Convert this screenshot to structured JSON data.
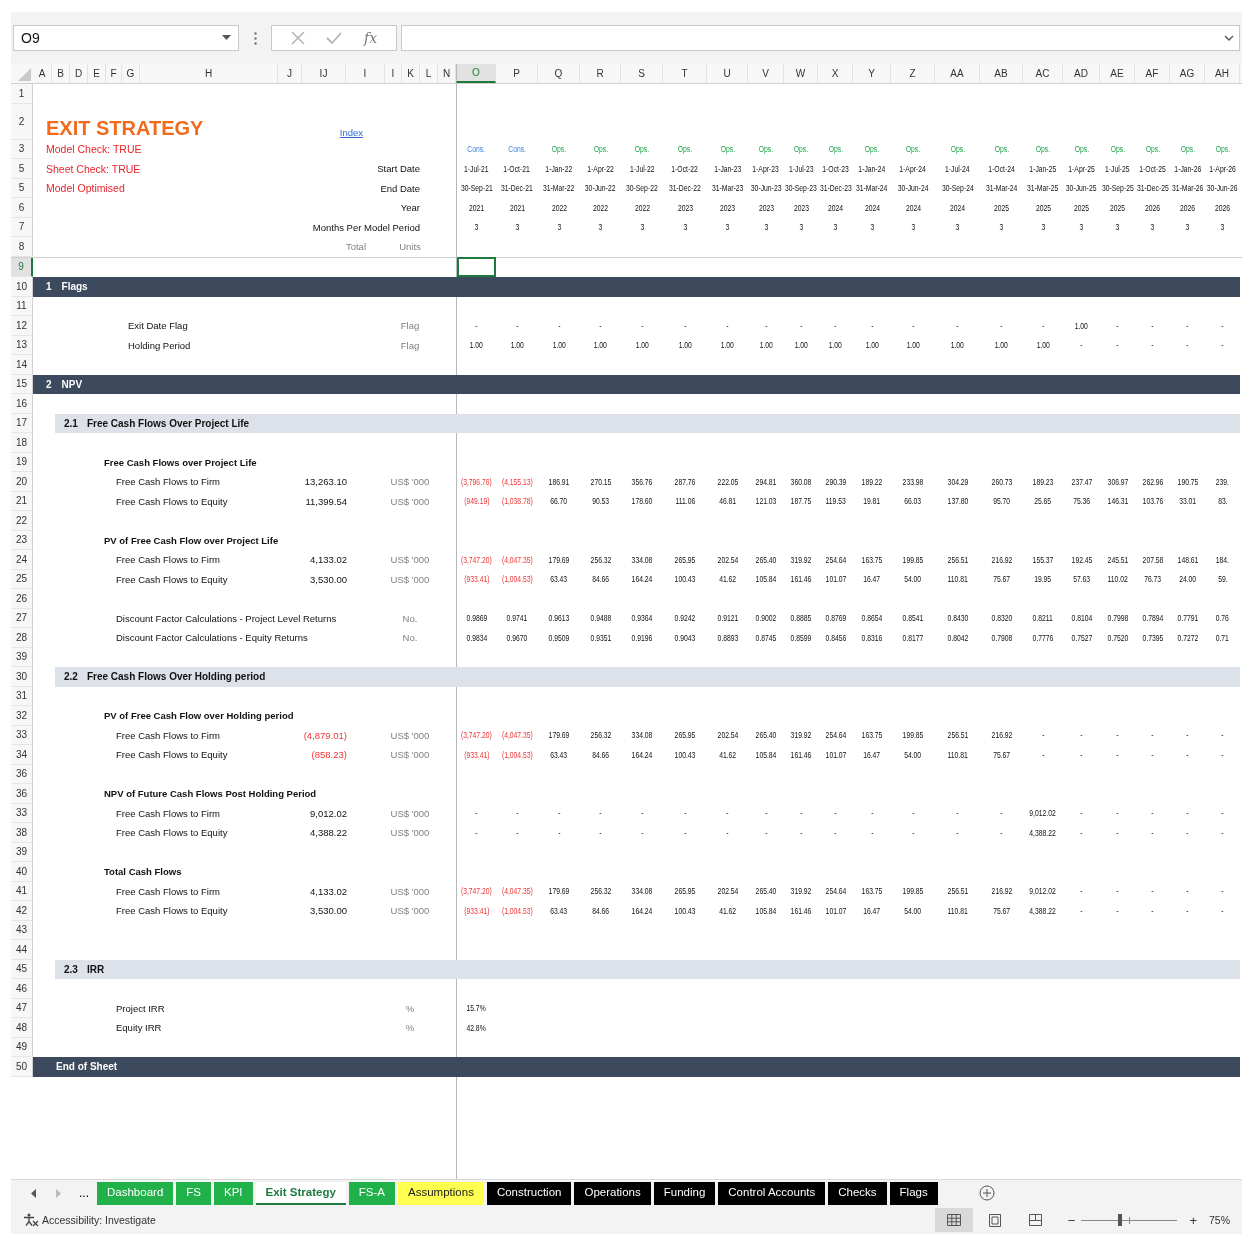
{
  "formula_bar": {
    "name_box": "O9",
    "function_label": "fx"
  },
  "columns": [
    {
      "label": "A",
      "selected": false
    },
    {
      "label": "B",
      "selected": false
    },
    {
      "label": "D",
      "selected": false
    },
    {
      "label": "E",
      "selected": false
    },
    {
      "label": "F",
      "selected": false
    },
    {
      "label": "G",
      "selected": false
    },
    {
      "label": "H",
      "selected": false
    },
    {
      "label": "J",
      "selected": false
    },
    {
      "label": "IJ",
      "selected": false
    },
    {
      "label": "I",
      "selected": false
    },
    {
      "label": "I",
      "selected": false
    },
    {
      "label": "K",
      "selected": false
    },
    {
      "label": "L",
      "selected": false
    },
    {
      "label": "N",
      "selected": false
    },
    {
      "label": "O",
      "selected": true
    },
    {
      "label": "P",
      "selected": false
    },
    {
      "label": "Q",
      "selected": false
    },
    {
      "label": "R",
      "selected": false
    },
    {
      "label": "S",
      "selected": false
    },
    {
      "label": "T",
      "selected": false
    },
    {
      "label": "U",
      "selected": false
    },
    {
      "label": "V",
      "selected": false
    },
    {
      "label": "W",
      "selected": false
    },
    {
      "label": "X",
      "selected": false
    },
    {
      "label": "Y",
      "selected": false
    },
    {
      "label": "Z",
      "selected": false
    },
    {
      "label": "AA",
      "selected": false
    },
    {
      "label": "AB",
      "selected": false
    },
    {
      "label": "AC",
      "selected": false
    },
    {
      "label": "AD",
      "selected": false
    },
    {
      "label": "AE",
      "selected": false
    },
    {
      "label": "AF",
      "selected": false
    },
    {
      "label": "AG",
      "selected": false
    },
    {
      "label": "AH",
      "selected": false
    }
  ],
  "rows": [
    {
      "number": "1",
      "kind": "blank",
      "selected": false
    },
    {
      "number": "2",
      "kind": "title",
      "selected": false,
      "title": "EXIT STRATEGY",
      "link": "Index"
    },
    {
      "number": "3",
      "kind": "phase",
      "selected": false,
      "check": "Model Check: TRUE",
      "values": [
        {
          "text": "Cons.",
          "kind": "construction"
        },
        {
          "text": "Cons.",
          "kind": "construction"
        },
        {
          "text": "Ops.",
          "kind": "operations"
        },
        {
          "text": "Ops.",
          "kind": "operations"
        },
        {
          "text": "Ops.",
          "kind": "operations"
        },
        {
          "text": "Ops.",
          "kind": "operations"
        },
        {
          "text": "Ops.",
          "kind": "operations"
        },
        {
          "text": "Ops.",
          "kind": "operations"
        },
        {
          "text": "Ops.",
          "kind": "operations"
        },
        {
          "text": "Ops.",
          "kind": "operations"
        },
        {
          "text": "Ops.",
          "kind": "operations"
        },
        {
          "text": "Ops.",
          "kind": "operations"
        },
        {
          "text": "Ops.",
          "kind": "operations"
        },
        {
          "text": "Ops.",
          "kind": "operations"
        },
        {
          "text": "Ops.",
          "kind": "operations"
        },
        {
          "text": "Ops.",
          "kind": "operations"
        },
        {
          "text": "Ops.",
          "kind": "operations"
        },
        {
          "text": "Ops.",
          "kind": "operations"
        },
        {
          "text": "Ops.",
          "kind": "operations"
        },
        {
          "text": "Ops.",
          "kind": "operations"
        }
      ]
    },
    {
      "number": "5",
      "kind": "timeline",
      "selected": false,
      "check": "Sheet Check: TRUE",
      "label": "Start Date",
      "values": [
        "1-Jul-21",
        "1-Oct-21",
        "1-Jan-22",
        "1-Apr-22",
        "1-Jul-22",
        "1-Oct-22",
        "1-Jan-23",
        "1-Apr-23",
        "1-Jul-23",
        "1-Oct-23",
        "1-Jan-24",
        "1-Apr-24",
        "1-Jul-24",
        "1-Oct-24",
        "1-Jan-25",
        "1-Apr-25",
        "1-Jul-25",
        "1-Oct-25",
        "1-Jan-26",
        "1-Apr-26"
      ]
    },
    {
      "number": "5",
      "kind": "timeline",
      "selected": false,
      "check": "Model Optimised",
      "label": "End Date",
      "values": [
        "30-Sep-21",
        "31-Dec-21",
        "31-Mar-22",
        "30-Jun-22",
        "30-Sep-22",
        "31-Dec-22",
        "31-Mar-23",
        "30-Jun-23",
        "30-Sep-23",
        "31-Dec-23",
        "31-Mar-24",
        "30-Jun-24",
        "30-Sep-24",
        "31-Mar-24",
        "31-Mar-25",
        "30-Jun-25",
        "30-Sep-25",
        "31-Dec-25",
        "31-Mar-26",
        "30-Jun-26"
      ]
    },
    {
      "number": "6",
      "kind": "timeline",
      "selected": false,
      "label": "Year",
      "values": [
        "2021",
        "2021",
        "2022",
        "2022",
        "2022",
        "2023",
        "2023",
        "2023",
        "2023",
        "2024",
        "2024",
        "2024",
        "2024",
        "2025",
        "2025",
        "2025",
        "2025",
        "2026",
        "2026",
        "2026"
      ]
    },
    {
      "number": "7",
      "kind": "timeline",
      "selected": false,
      "label": "Months Per Model Period",
      "values": [
        "3",
        "3",
        "3",
        "3",
        "3",
        "3",
        "3",
        "3",
        "3",
        "3",
        "3",
        "3",
        "3",
        "3",
        "3",
        "3",
        "3",
        "3",
        "3",
        "3"
      ]
    },
    {
      "number": "8",
      "kind": "header",
      "selected": false,
      "total": "Total",
      "unit": "Units"
    },
    {
      "number": "9",
      "kind": "blank",
      "selected": true
    },
    {
      "number": "10",
      "kind": "section",
      "selected": false,
      "index": "1",
      "title": "Flags"
    },
    {
      "number": "11",
      "kind": "blank",
      "selected": false
    },
    {
      "number": "12",
      "kind": "flag",
      "selected": false,
      "label": "Exit Date Flag",
      "unit": "Flag",
      "values": [
        "-",
        "-",
        "-",
        "-",
        "-",
        "-",
        "-",
        "-",
        "-",
        "-",
        "-",
        "-",
        "-",
        "-",
        "-",
        "1.00",
        "-",
        "-",
        "-",
        "-"
      ]
    },
    {
      "number": "13",
      "kind": "flag",
      "selected": false,
      "label": "Holding Period",
      "unit": "Flag",
      "values": [
        "1.00",
        "1.00",
        "1.00",
        "1.00",
        "1.00",
        "1.00",
        "1.00",
        "1.00",
        "1.00",
        "1.00",
        "1.00",
        "1.00",
        "1.00",
        "1.00",
        "1.00",
        "-",
        "-",
        "-",
        "-",
        "-"
      ]
    },
    {
      "number": "14",
      "kind": "blank",
      "selected": false
    },
    {
      "number": "15",
      "kind": "section",
      "selected": false,
      "index": "2",
      "title": "NPV"
    },
    {
      "number": "16",
      "kind": "blank",
      "selected": false
    },
    {
      "number": "17",
      "kind": "subsection",
      "selected": false,
      "index": "2.1",
      "title": "Free Cash Flows Over Project Life"
    },
    {
      "number": "18",
      "kind": "blank",
      "selected": false
    },
    {
      "number": "19",
      "kind": "heading",
      "selected": false,
      "label": "Free Cash Flows over Project Life"
    },
    {
      "number": "20",
      "kind": "item",
      "selected": false,
      "label": "Free Cash Flows to Firm",
      "total": "13,263.10",
      "unit": "US$ '000",
      "values": [
        {
          "text": "(3,796.76)",
          "negative": true
        },
        {
          "text": "(4,155.13)",
          "negative": true
        },
        "186.91",
        "270.15",
        "356.76",
        "287.76",
        "222.05",
        "294.81",
        "360.08",
        "290.39",
        "189.22",
        "233.98",
        "304.29",
        "260.73",
        "189.23",
        "237.47",
        "306.97",
        "262.96",
        "190.75",
        "239."
      ]
    },
    {
      "number": "21",
      "kind": "item",
      "selected": false,
      "label": "Free Cash Flows to Equity",
      "total": "11,399.54",
      "unit": "US$ '000",
      "values": [
        {
          "text": "(949.19)",
          "negative": true
        },
        {
          "text": "(1,038.78)",
          "negative": true
        },
        "66.70",
        "90.53",
        "178.60",
        "111.06",
        "46.81",
        "121.03",
        "187.75",
        "119.53",
        "19.81",
        "66.03",
        "137.80",
        "95.70",
        "25.65",
        "75.36",
        "146.31",
        "103.76",
        "33.01",
        "83."
      ]
    },
    {
      "number": "22",
      "kind": "blank",
      "selected": false
    },
    {
      "number": "23",
      "kind": "heading",
      "selected": false,
      "label": "PV of Free Cash Flow over Project Life"
    },
    {
      "number": "24",
      "kind": "item",
      "selected": false,
      "label": "Free Cash Flows to Firm",
      "total": "4,133.02",
      "unit": "US$ '000",
      "values": [
        {
          "text": "(3,747.20)",
          "negative": true
        },
        {
          "text": "(4,047.35)",
          "negative": true
        },
        "179.69",
        "256.32",
        "334.08",
        "265.95",
        "202.54",
        "265.40",
        "319.92",
        "254.64",
        "163.75",
        "199.85",
        "256.51",
        "216.92",
        "155.37",
        "192.45",
        "245.51",
        "207.58",
        "148.61",
        "184."
      ]
    },
    {
      "number": "25",
      "kind": "item",
      "selected": false,
      "label": "Free Cash Flows to Equity",
      "total": "3,530.00",
      "unit": "US$ '000",
      "values": [
        {
          "text": "(933.41)",
          "negative": true
        },
        {
          "text": "(1,004.53)",
          "negative": true
        },
        "63.43",
        "84.66",
        "164.24",
        "100.43",
        "41.62",
        "105.84",
        "161.46",
        "101.07",
        "16.47",
        "54.00",
        "110.81",
        "75.67",
        "19.95",
        "57.63",
        "110.02",
        "76.73",
        "24.00",
        "59."
      ]
    },
    {
      "number": "26",
      "kind": "blank",
      "selected": false
    },
    {
      "number": "27",
      "kind": "item",
      "selected": false,
      "label": "Discount Factor Calculations - Project Level Returns",
      "unit": "No.",
      "values": [
        "0.9869",
        "0.9741",
        "0.9613",
        "0.9488",
        "0.9364",
        "0.9242",
        "0.9121",
        "0.9002",
        "0.8885",
        "0.8769",
        "0.8654",
        "0.8541",
        "0.8430",
        "0.8320",
        "0.8211",
        "0.8104",
        "0.7998",
        "0.7894",
        "0.7791",
        "0.76"
      ]
    },
    {
      "number": "28",
      "kind": "item",
      "selected": false,
      "label": "Discount Factor Calculations - Equity Returns",
      "unit": "No.",
      "values": [
        "0.9834",
        "0.9670",
        "0.9509",
        "0.9351",
        "0.9196",
        "0.9043",
        "0.8893",
        "0.8745",
        "0.8599",
        "0.8456",
        "0.8316",
        "0.8177",
        "0.8042",
        "0.7908",
        "0.7776",
        "0.7527",
        "0.7520",
        "0.7395",
        "0.7272",
        "0.71"
      ]
    },
    {
      "number": "39",
      "kind": "blank",
      "selected": false
    },
    {
      "number": "30",
      "kind": "subsection",
      "selected": false,
      "index": "2.2",
      "title": "Free Cash Flows Over Holding period"
    },
    {
      "number": "31",
      "kind": "blank",
      "selected": false
    },
    {
      "number": "32",
      "kind": "heading",
      "selected": false,
      "label": "PV of Free Cash Flow over Holding period"
    },
    {
      "number": "33",
      "kind": "item",
      "selected": false,
      "label": "Free Cash Flows to Firm",
      "total": {
        "text": "(4,879.01)",
        "negative": true
      },
      "unit": "US$ '000",
      "values": [
        {
          "text": "(3,747.20)",
          "negative": true
        },
        {
          "text": "(4,047.35)",
          "negative": true
        },
        "179.69",
        "256.32",
        "334.08",
        "265.95",
        "202.54",
        "265.40",
        "319.92",
        "254.64",
        "163.75",
        "199.85",
        "256.51",
        "216.92",
        "-",
        "-",
        "-",
        "-",
        "-",
        "-"
      ]
    },
    {
      "number": "34",
      "kind": "item",
      "selected": false,
      "label": "Free Cash Flows to Equity",
      "total": {
        "text": "(858.23)",
        "negative": true
      },
      "unit": "US$ '000",
      "values": [
        {
          "text": "(933.41)",
          "negative": true
        },
        {
          "text": "(1,004.53)",
          "negative": true
        },
        "63.43",
        "84.66",
        "164.24",
        "100.43",
        "41.62",
        "105.84",
        "161.46",
        "101.07",
        "16.47",
        "54.00",
        "110.81",
        "75.67",
        "-",
        "-",
        "-",
        "-",
        "-",
        "-"
      ]
    },
    {
      "number": "36",
      "kind": "blank",
      "selected": false
    },
    {
      "number": "36",
      "kind": "heading",
      "selected": false,
      "label": "NPV of Future Cash Flows Post Holding Period"
    },
    {
      "number": "33",
      "kind": "item",
      "selected": false,
      "label": "Free Cash Flows to Firm",
      "total": "9,012.02",
      "unit": "US$ '000",
      "values": [
        "-",
        "-",
        "-",
        "-",
        "-",
        "-",
        "-",
        "-",
        "-",
        "-",
        "-",
        "-",
        "-",
        "-",
        "9,012.02",
        "-",
        "-",
        "-",
        "-",
        "-"
      ]
    },
    {
      "number": "38",
      "kind": "item",
      "selected": false,
      "label": "Free Cash Flows to Equity",
      "total": "4,388.22",
      "unit": "US$ '000",
      "values": [
        "-",
        "-",
        "-",
        "-",
        "-",
        "-",
        "-",
        "-",
        "-",
        "-",
        "-",
        "-",
        "-",
        "-",
        "4,388.22",
        "-",
        "-",
        "-",
        "-",
        "-"
      ]
    },
    {
      "number": "39",
      "kind": "blank",
      "selected": false
    },
    {
      "number": "40",
      "kind": "heading",
      "selected": false,
      "label": "Total Cash Flows"
    },
    {
      "number": "41",
      "kind": "item",
      "selected": false,
      "label": "Free Cash Flows to Firm",
      "total": "4,133.02",
      "unit": "US$ '000",
      "values": [
        {
          "text": "(3,747.20)",
          "negative": true
        },
        {
          "text": "(4,047.35)",
          "negative": true
        },
        "179.69",
        "256.32",
        "334.08",
        "265.95",
        "202.54",
        "265.40",
        "319.92",
        "254.64",
        "163.75",
        "199.85",
        "256.51",
        "216.92",
        "9,012.02",
        "-",
        "-",
        "-",
        "-",
        "-"
      ]
    },
    {
      "number": "42",
      "kind": "item",
      "selected": false,
      "label": "Free Cash Flows to Equity",
      "total": "3,530.00",
      "unit": "US$ '000",
      "values": [
        {
          "text": "(933.41)",
          "negative": true
        },
        {
          "text": "(1,004.53)",
          "negative": true
        },
        "63.43",
        "84.66",
        "164.24",
        "100.43",
        "41.62",
        "105.84",
        "161.46",
        "101.07",
        "16.47",
        "54.00",
        "110.81",
        "75.67",
        "4,388.22",
        "-",
        "-",
        "-",
        "-",
        "-"
      ]
    },
    {
      "number": "43",
      "kind": "blank",
      "selected": false
    },
    {
      "number": "44",
      "kind": "blank",
      "selected": false
    },
    {
      "number": "45",
      "kind": "subsection",
      "selected": false,
      "index": "2.3",
      "title": "IRR"
    },
    {
      "number": "46",
      "kind": "blank",
      "selected": false
    },
    {
      "number": "47",
      "kind": "item",
      "selected": false,
      "label": "Project IRR",
      "unit": "%",
      "values": [
        "15.7%"
      ]
    },
    {
      "number": "48",
      "kind": "item",
      "selected": false,
      "label": "Equity IRR",
      "unit": "%",
      "values": [
        "42.8%"
      ]
    },
    {
      "number": "49",
      "kind": "blank",
      "selected": false
    },
    {
      "number": "50",
      "kind": "end",
      "selected": false,
      "title": "End of Sheet"
    }
  ],
  "sheet_nav": {
    "more": "..."
  },
  "tabs": [
    {
      "label": "Dashboard",
      "color": "#21b14a",
      "selected": false
    },
    {
      "label": "FS",
      "color": "#21b14a",
      "selected": false
    },
    {
      "label": "KPI",
      "color": "#21b14a",
      "selected": false
    },
    {
      "label": "Exit Strategy",
      "color": "#1e7b3d",
      "selected": true
    },
    {
      "label": "FS-A",
      "color": "#21b14a",
      "selected": false
    },
    {
      "label": "Assumptions",
      "color": "#ffff4f",
      "selected": false
    },
    {
      "label": "Construction",
      "color": "#000000",
      "selected": false
    },
    {
      "label": "Operations",
      "color": "#000000",
      "selected": false
    },
    {
      "label": "Funding",
      "color": "#000000",
      "selected": false
    },
    {
      "label": "Control Accounts",
      "color": "#000000",
      "selected": false
    },
    {
      "label": "Checks",
      "color": "#000000",
      "selected": false
    },
    {
      "label": "Flags",
      "color": "#000000",
      "selected": false
    }
  ],
  "status_bar": {
    "accessibility": "Accessibility: Investigate",
    "views": [
      {
        "kind": "normal",
        "selected": true
      },
      {
        "kind": "page_layout",
        "selected": false
      },
      {
        "kind": "page_break",
        "selected": false
      }
    ],
    "zoom_out": "−",
    "zoom": {
      "level": 0.4
    },
    "zoom_in": "+",
    "zoom_label": "75%"
  }
}
